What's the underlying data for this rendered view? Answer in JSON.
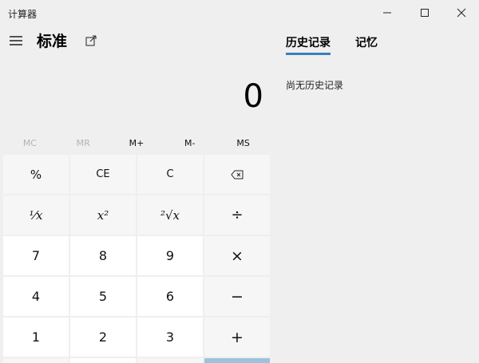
{
  "window": {
    "title": "计算器",
    "controls": [
      "minimize-icon",
      "maximize-icon",
      "close-icon"
    ]
  },
  "header": {
    "mode": "标准",
    "menu_icon": "hamburger-icon",
    "keep_on_top_icon": "keep-on-top-icon"
  },
  "display": {
    "value": "0"
  },
  "memory": {
    "mc": "MC",
    "mr": "MR",
    "mplus": "M+",
    "mminus": "M-",
    "ms": "MS"
  },
  "keys": {
    "percent": "%",
    "ce": "CE",
    "c": "C",
    "backspace_icon": "backspace-icon",
    "reciprocal": "⅟x",
    "square": "x²",
    "sqrt": "²√x",
    "divide": "÷",
    "n7": "7",
    "n8": "8",
    "n9": "9",
    "multiply": "×",
    "n4": "4",
    "n5": "5",
    "n6": "6",
    "minus": "−",
    "n1": "1",
    "n2": "2",
    "n3": "3",
    "plus": "+"
  },
  "history": {
    "tabs": [
      "历史记录",
      "记忆"
    ],
    "active_tab": "历史记录",
    "empty_text": "尚无历史记录"
  },
  "colors": {
    "accent": "#3a7fbd",
    "equals": "#9dc3dc",
    "background": "#efefef"
  }
}
